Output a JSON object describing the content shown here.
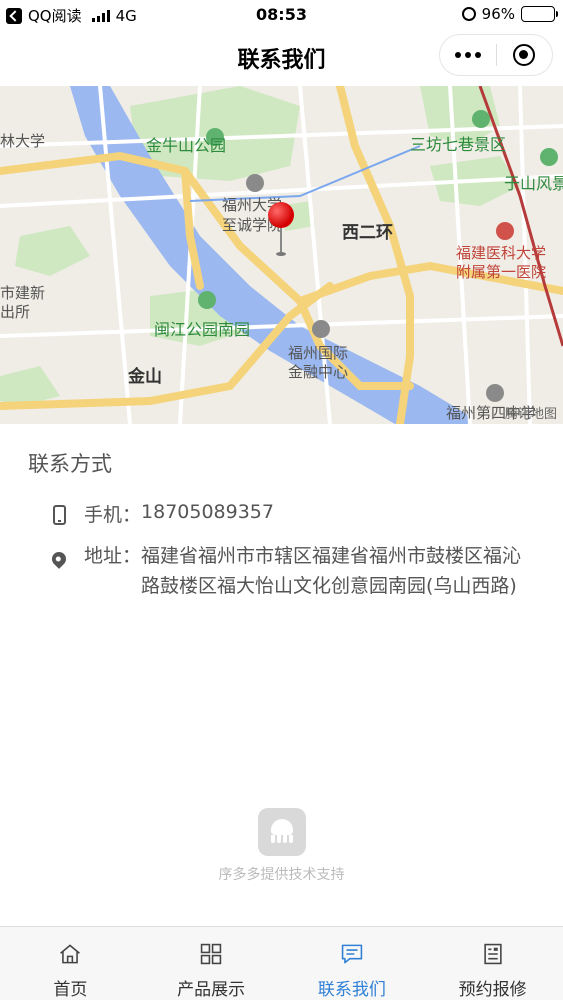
{
  "status_bar": {
    "carrier": "QQ阅读",
    "network": "4G",
    "time": "08:53",
    "battery": "96%"
  },
  "navbar": {
    "title": "联系我们"
  },
  "map": {
    "labels": {
      "park_jinniu": "金牛山公园",
      "sanfang": "三坊七巷景区",
      "yushan": "于山风景",
      "fzu_zhicheng_1": "福州大学",
      "fzu_zhicheng_2": "至诚学院",
      "xierhuan": "西二环",
      "hospital_1": "福建医科大学",
      "hospital_2": "附属第一医院",
      "minjiang_park": "闽江公园南园",
      "finance_1": "福州国际",
      "finance_2": "金融中心",
      "jinshan": "金山",
      "school": "福州第四中学",
      "linda": "林大学",
      "jianxin_1": "市建新",
      "jianxin_2": "出所"
    },
    "logo": "腾讯地图"
  },
  "contact": {
    "title": "联系方式",
    "phone_label": "手机：",
    "phone": "18705089357",
    "address_label": "地址：",
    "address": "福建省福州市市辖区福建省福州市鼓楼区福沁路鼓楼区福大怡山文化创意园南园(乌山西路)"
  },
  "footer": {
    "support": "序多多提供技术支持"
  },
  "tabbar": {
    "items": [
      {
        "label": "首页",
        "icon": "home-icon",
        "active": false
      },
      {
        "label": "产品展示",
        "icon": "grid-icon",
        "active": false
      },
      {
        "label": "联系我们",
        "icon": "chat-icon",
        "active": true
      },
      {
        "label": "预约报修",
        "icon": "form-icon",
        "active": false
      }
    ],
    "active_color": "#2f80d6"
  }
}
